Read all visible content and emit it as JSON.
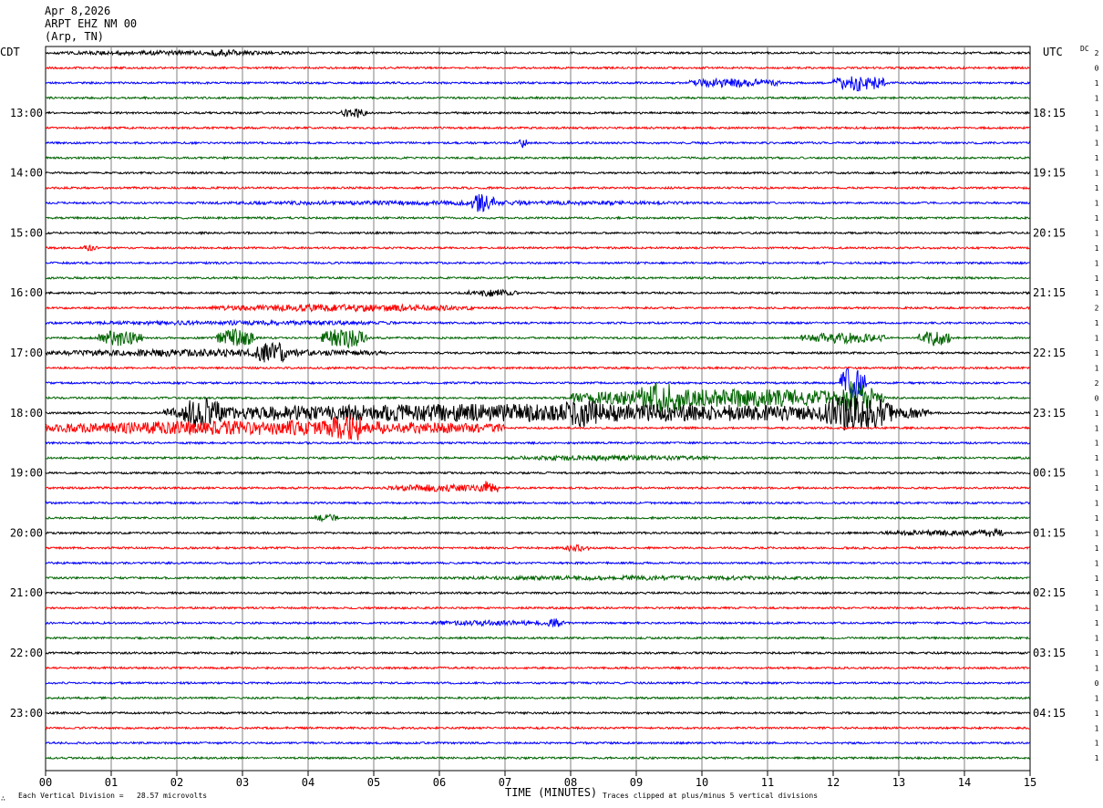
{
  "header": {
    "date": "Apr 8,2026",
    "station": "ARPT EHZ NM 00",
    "location": "(Arp, TN)",
    "left_tz": "CDT",
    "right_tz": "UTC",
    "dc_label": "DC"
  },
  "footer": {
    "division_note": "Each Vertical Division =   28.57 microvolts",
    "xlabel": "TIME (MINUTES)",
    "clip_note": "Traces clipped at plus/minus 5 vertical divisions",
    "corner_mark": "∴"
  },
  "colors": {
    "cycle": [
      "#000000",
      "#ff0000",
      "#0000ff",
      "#006400"
    ],
    "grid": "#808080"
  },
  "chart_data": {
    "type": "helicorder",
    "xlabel": "TIME (MINUTES)",
    "xlim": [
      0,
      15
    ],
    "x_ticks": [
      "00",
      "01",
      "02",
      "03",
      "04",
      "05",
      "06",
      "07",
      "08",
      "09",
      "10",
      "11",
      "12",
      "13",
      "14",
      "15"
    ],
    "lines_per_hour": 4,
    "trace_count": 48,
    "left_hour_labels": [
      "13:00",
      "14:00",
      "15:00",
      "16:00",
      "17:00",
      "18:00",
      "19:00",
      "20:00",
      "21:00",
      "22:00",
      "23:00"
    ],
    "right_hour_labels": [
      "18:15",
      "19:15",
      "20:15",
      "21:15",
      "22:15",
      "23:15",
      "00:15",
      "01:15",
      "02:15",
      "03:15",
      "04:15"
    ],
    "dc_offsets": [
      "2",
      "0",
      "1",
      "1",
      "1",
      "1",
      "1",
      "1",
      "1",
      "1",
      "1",
      "1",
      "1",
      "1",
      "1",
      "1",
      "1",
      "2",
      "1",
      "1",
      "1",
      "1",
      "2",
      "0",
      "1",
      "1",
      "1",
      "1",
      "1",
      "1",
      "1",
      "1",
      "1",
      "1",
      "1",
      "1",
      "1",
      "1",
      "1",
      "1",
      "1",
      "1",
      "0",
      "1",
      "1",
      "1",
      "1",
      "1"
    ],
    "events": [
      {
        "trace": 0,
        "start": 0,
        "end": 4,
        "amp": 2.5
      },
      {
        "trace": 0,
        "start": 2.4,
        "end": 3.0,
        "amp": 4
      },
      {
        "trace": 2,
        "start": 9.8,
        "end": 11.2,
        "amp": 5
      },
      {
        "trace": 2,
        "start": 12.0,
        "end": 12.8,
        "amp": 9
      },
      {
        "trace": 4,
        "start": 4.5,
        "end": 4.9,
        "amp": 6
      },
      {
        "trace": 6,
        "start": 7.2,
        "end": 7.35,
        "amp": 5
      },
      {
        "trace": 10,
        "start": 2.2,
        "end": 10.2,
        "amp": 2.5
      },
      {
        "trace": 10,
        "start": 6.5,
        "end": 6.9,
        "amp": 12
      },
      {
        "trace": 13,
        "start": 0.5,
        "end": 0.8,
        "amp": 3
      },
      {
        "trace": 16,
        "start": 6.4,
        "end": 7.2,
        "amp": 4
      },
      {
        "trace": 17,
        "start": 2.5,
        "end": 6.5,
        "amp": 4
      },
      {
        "trace": 18,
        "start": 0.5,
        "end": 5.5,
        "amp": 2.5
      },
      {
        "trace": 19,
        "start": 0.8,
        "end": 1.5,
        "amp": 9
      },
      {
        "trace": 19,
        "start": 2.6,
        "end": 3.2,
        "amp": 10
      },
      {
        "trace": 19,
        "start": 4.2,
        "end": 4.9,
        "amp": 11
      },
      {
        "trace": 19,
        "start": 11.5,
        "end": 12.8,
        "amp": 6
      },
      {
        "trace": 19,
        "start": 13.3,
        "end": 13.8,
        "amp": 9
      },
      {
        "trace": 20,
        "start": 0,
        "end": 5.2,
        "amp": 4
      },
      {
        "trace": 20,
        "start": 3.2,
        "end": 3.7,
        "amp": 12
      },
      {
        "trace": 22,
        "start": 12.1,
        "end": 12.5,
        "amp": 18
      },
      {
        "trace": 23,
        "start": 8.0,
        "end": 12.8,
        "amp": 10
      },
      {
        "trace": 23,
        "start": 9.0,
        "end": 9.8,
        "amp": 18
      },
      {
        "trace": 23,
        "start": 12.1,
        "end": 12.6,
        "amp": 20
      },
      {
        "trace": 24,
        "start": 1.8,
        "end": 13.5,
        "amp": 10
      },
      {
        "trace": 24,
        "start": 2.1,
        "end": 2.7,
        "amp": 18
      },
      {
        "trace": 24,
        "start": 7.8,
        "end": 8.5,
        "amp": 16
      },
      {
        "trace": 24,
        "start": 11.8,
        "end": 12.9,
        "amp": 20
      },
      {
        "trace": 25,
        "start": 0,
        "end": 7.0,
        "amp": 8
      },
      {
        "trace": 25,
        "start": 4.3,
        "end": 4.9,
        "amp": 16
      },
      {
        "trace": 27,
        "start": 7.0,
        "end": 10.2,
        "amp": 3
      },
      {
        "trace": 29,
        "start": 5.2,
        "end": 6.9,
        "amp": 4
      },
      {
        "trace": 29,
        "start": 6.6,
        "end": 6.9,
        "amp": 8
      },
      {
        "trace": 31,
        "start": 4.1,
        "end": 4.5,
        "amp": 4
      },
      {
        "trace": 32,
        "start": 12.7,
        "end": 14.6,
        "amp": 3
      },
      {
        "trace": 32,
        "start": 14.2,
        "end": 14.6,
        "amp": 5
      },
      {
        "trace": 33,
        "start": 7.9,
        "end": 8.3,
        "amp": 4
      },
      {
        "trace": 35,
        "start": 6.0,
        "end": 12.0,
        "amp": 2.5
      },
      {
        "trace": 38,
        "start": 5.8,
        "end": 7.9,
        "amp": 3
      },
      {
        "trace": 38,
        "start": 7.6,
        "end": 7.9,
        "amp": 5
      }
    ]
  }
}
